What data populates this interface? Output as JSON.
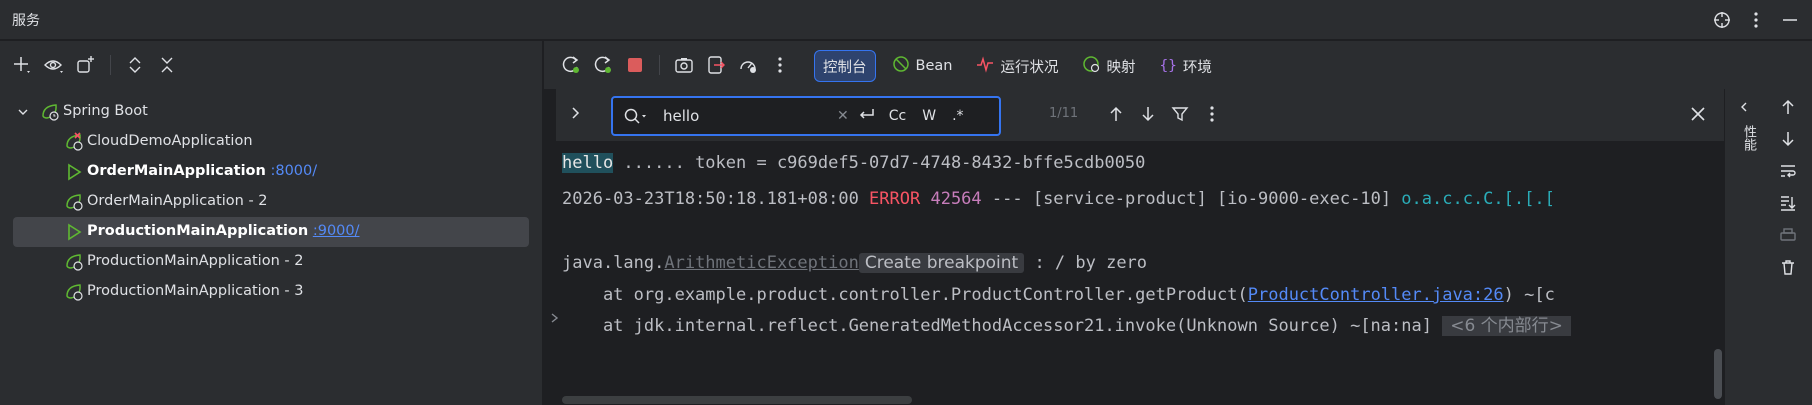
{
  "window": {
    "title": "服务"
  },
  "tree": {
    "root": "Spring Boot",
    "apps": [
      {
        "name": "CloudDemoApplication",
        "port": "",
        "bold": false,
        "status": "error"
      },
      {
        "name": "OrderMainApplication",
        "port": ":8000/",
        "bold": true,
        "status": "running"
      },
      {
        "name": "OrderMainApplication - 2",
        "port": "",
        "bold": false,
        "status": "stopped"
      },
      {
        "name": "ProductionMainApplication",
        "port": ":9000/",
        "bold": true,
        "status": "running"
      },
      {
        "name": "ProductionMainApplication - 2",
        "port": "",
        "bold": false,
        "status": "stopped"
      },
      {
        "name": "ProductionMainApplication - 3",
        "port": "",
        "bold": false,
        "status": "stopped"
      }
    ]
  },
  "tabs": [
    {
      "label": "控制台",
      "active": true
    },
    {
      "label": "Bean",
      "active": false
    },
    {
      "label": "运行状况",
      "active": false
    },
    {
      "label": "映射",
      "active": false
    },
    {
      "label": "环境",
      "active": false
    }
  ],
  "find": {
    "query": "hello",
    "opt_case": "Cc",
    "opt_word": "W",
    "opt_regex": ".*",
    "match_count": "1/11"
  },
  "console": {
    "line1_hit": "hello",
    "line1_rest": " ...... token = c969def5-07d7-4748-8432-bffe5cdb0050",
    "line2_ts": "2026-03-23T18:50:18.181+08:00 ",
    "line2_level": "ERROR",
    "line2_pid": " 42564",
    "line2_mid": " --- [service-product] [io-9000-exec-10] ",
    "line2_cls": "o.a.c.c.C.[.[.[",
    "line4_pre": "java.lang.",
    "line4_exc": "ArithmeticException",
    "line4_bp": "Create breakpoint",
    "line4_post": " : / by zero",
    "line5_pre": "    at org.example.product.controller.ProductController.getProduct(",
    "line5_link": "ProductController.java:26",
    "line5_post": ") ~[c",
    "line6_pre": "    at jdk.internal.reflect.GeneratedMethodAccessor21.invoke(Unknown Source) ~[na:na]",
    "line6_inner": "<6 个内部行>"
  },
  "side": {
    "perf_label": "性能"
  },
  "colors": {
    "accent": "#3574f0",
    "error": "#f75464",
    "pid": "#c77dbb",
    "class": "#2aacb8",
    "link": "#548af7"
  }
}
